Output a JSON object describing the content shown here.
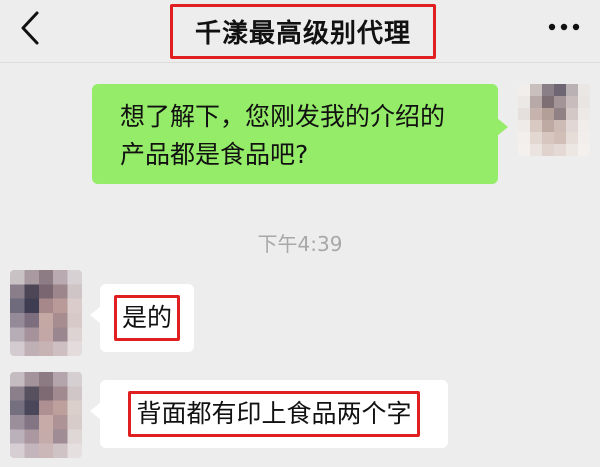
{
  "header": {
    "back_icon": "chevron-left-icon",
    "title": "千漾最高级别代理",
    "more_icon": "more-dots-icon"
  },
  "messages": [
    {
      "direction": "sent",
      "lines": [
        "想了解下，您刚发我的介绍的",
        "产品都是食品吧?"
      ]
    },
    {
      "type": "timestamp",
      "text": "下午4:39"
    },
    {
      "direction": "received",
      "text": "是的",
      "highlighted": true
    },
    {
      "direction": "received",
      "text": "背面都有印上食品两个字",
      "highlighted": true
    }
  ],
  "colors": {
    "background": "#ededed",
    "sent_bubble": "#95ec69",
    "received_bubble": "#ffffff",
    "highlight_border": "#e02020",
    "timestamp_text": "#a8a8a8"
  }
}
